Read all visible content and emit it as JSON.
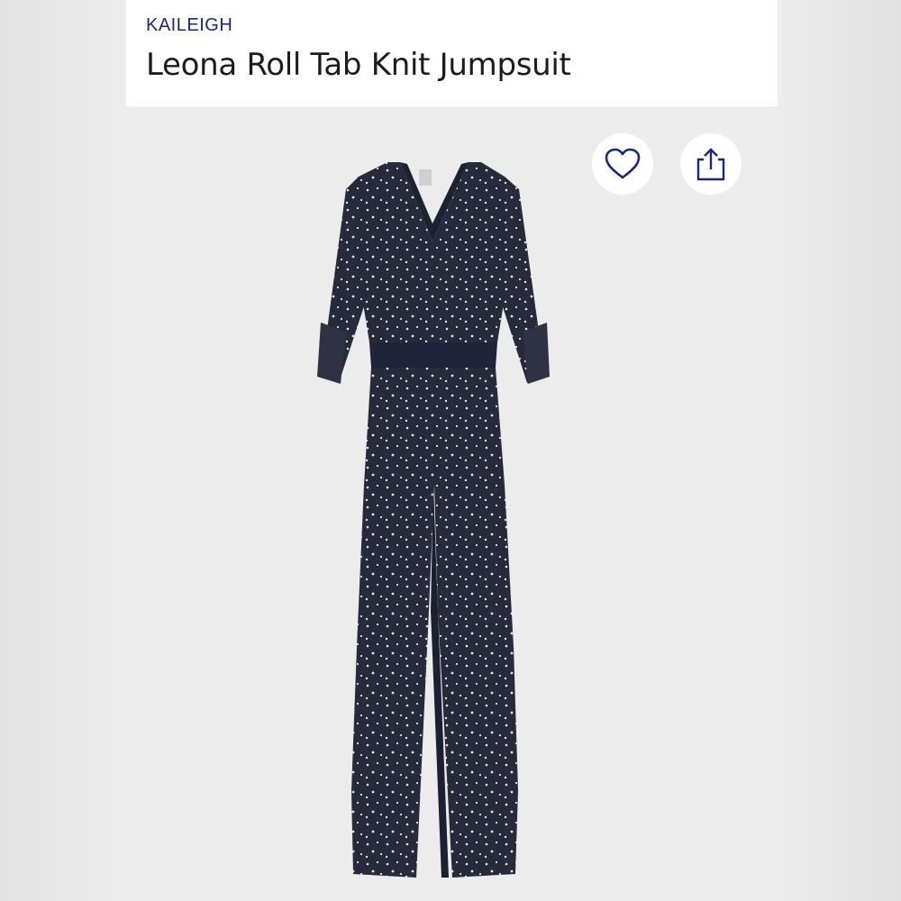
{
  "product": {
    "brand": "KAILEIGH",
    "name": "Leona Roll Tab Knit Jumpsuit"
  },
  "actions": {
    "favorite_icon": "heart-outline-icon",
    "share_icon": "share-upload-icon"
  },
  "colors": {
    "brand_text": "#1a2a6c",
    "garment": "#262a3a",
    "pattern_dots": "#e6e6e6"
  }
}
